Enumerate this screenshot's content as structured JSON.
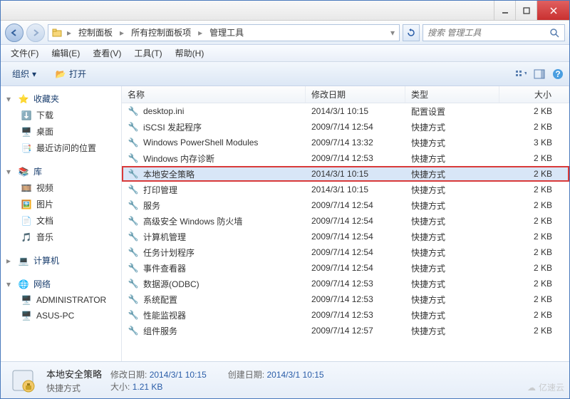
{
  "titlebar": {
    "min": "–",
    "max": "▢",
    "close": "✕"
  },
  "nav": {
    "breadcrumbs": [
      "控制面板",
      "所有控制面板项",
      "管理工具"
    ],
    "search_placeholder": "搜索 管理工具"
  },
  "menubar": [
    "文件(F)",
    "编辑(E)",
    "查看(V)",
    "工具(T)",
    "帮助(H)"
  ],
  "toolbar": {
    "organize": "组织",
    "open": "打开"
  },
  "sidebar": {
    "favorites": {
      "label": "收藏夹",
      "items": [
        "下载",
        "桌面",
        "最近访问的位置"
      ]
    },
    "libraries": {
      "label": "库",
      "items": [
        "视频",
        "图片",
        "文档",
        "音乐"
      ]
    },
    "computer": {
      "label": "计算机"
    },
    "network": {
      "label": "网络",
      "items": [
        "ADMINISTRATOR",
        "ASUS-PC"
      ]
    }
  },
  "columns": {
    "name": "名称",
    "date": "修改日期",
    "type": "类型",
    "size": "大小"
  },
  "files": [
    {
      "name": "desktop.ini",
      "date": "2014/3/1 10:15",
      "type": "配置设置",
      "size": "2 KB"
    },
    {
      "name": "iSCSI 发起程序",
      "date": "2009/7/14 12:54",
      "type": "快捷方式",
      "size": "2 KB"
    },
    {
      "name": "Windows PowerShell Modules",
      "date": "2009/7/14 13:32",
      "type": "快捷方式",
      "size": "3 KB"
    },
    {
      "name": "Windows 内存诊断",
      "date": "2009/7/14 12:53",
      "type": "快捷方式",
      "size": "2 KB"
    },
    {
      "name": "本地安全策略",
      "date": "2014/3/1 10:15",
      "type": "快捷方式",
      "size": "2 KB",
      "selected": true,
      "highlighted": true
    },
    {
      "name": "打印管理",
      "date": "2014/3/1 10:15",
      "type": "快捷方式",
      "size": "2 KB"
    },
    {
      "name": "服务",
      "date": "2009/7/14 12:54",
      "type": "快捷方式",
      "size": "2 KB"
    },
    {
      "name": "高级安全 Windows 防火墙",
      "date": "2009/7/14 12:54",
      "type": "快捷方式",
      "size": "2 KB"
    },
    {
      "name": "计算机管理",
      "date": "2009/7/14 12:54",
      "type": "快捷方式",
      "size": "2 KB"
    },
    {
      "name": "任务计划程序",
      "date": "2009/7/14 12:54",
      "type": "快捷方式",
      "size": "2 KB"
    },
    {
      "name": "事件查看器",
      "date": "2009/7/14 12:54",
      "type": "快捷方式",
      "size": "2 KB"
    },
    {
      "name": "数据源(ODBC)",
      "date": "2009/7/14 12:53",
      "type": "快捷方式",
      "size": "2 KB"
    },
    {
      "name": "系统配置",
      "date": "2009/7/14 12:53",
      "type": "快捷方式",
      "size": "2 KB"
    },
    {
      "name": "性能监视器",
      "date": "2009/7/14 12:53",
      "type": "快捷方式",
      "size": "2 KB"
    },
    {
      "name": "组件服务",
      "date": "2009/7/14 12:57",
      "type": "快捷方式",
      "size": "2 KB"
    }
  ],
  "status": {
    "title": "本地安全策略",
    "subtitle": "快捷方式",
    "modified_label": "修改日期:",
    "modified": "2014/3/1 10:15",
    "created_label": "创建日期:",
    "created": "2014/3/1 10:15",
    "size_label": "大小:",
    "size": "1.21 KB"
  },
  "watermark": "亿速云"
}
